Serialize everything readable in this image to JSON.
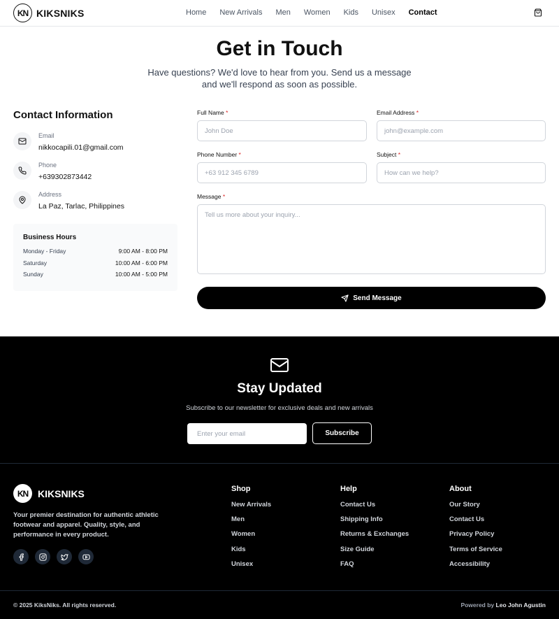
{
  "nav": {
    "logo_mark": "KN",
    "brand": "KIKSNIKS",
    "links": [
      "Home",
      "New Arrivals",
      "Men",
      "Women",
      "Kids",
      "Unisex",
      "Contact"
    ],
    "active": "Contact",
    "cart_icon": "cart-icon"
  },
  "hero": {
    "title": "Get in Touch",
    "subtitle": "Have questions? We'd love to hear from you. Send us a message and we'll respond as soon as possible."
  },
  "contact_info": {
    "title": "Contact Information",
    "items": [
      {
        "icon": "mail-icon",
        "label": "Email",
        "value": "nikkocapili.01@gmail.com"
      },
      {
        "icon": "phone-icon",
        "label": "Phone",
        "value": "+639302873442"
      },
      {
        "icon": "map-pin-icon",
        "label": "Address",
        "value": "La Paz, Tarlac, Philippines"
      }
    ]
  },
  "hours": {
    "title": "Business Hours",
    "rows": [
      {
        "day": "Monday - Friday",
        "time": "9:00 AM - 8:00 PM"
      },
      {
        "day": "Saturday",
        "time": "10:00 AM - 6:00 PM"
      },
      {
        "day": "Sunday",
        "time": "10:00 AM - 5:00 PM"
      }
    ]
  },
  "form": {
    "full_name": {
      "label": "Full Name",
      "placeholder": "John Doe"
    },
    "email": {
      "label": "Email Address",
      "placeholder": "john@example.com"
    },
    "phone": {
      "label": "Phone Number",
      "placeholder": "+63 912 345 6789"
    },
    "subject": {
      "label": "Subject",
      "placeholder": "How can we help?"
    },
    "message": {
      "label": "Message",
      "placeholder": "Tell us more about your inquiry..."
    },
    "required_mark": "*",
    "submit": "Send Message"
  },
  "newsletter": {
    "title": "Stay Updated",
    "subtitle": "Subscribe to our newsletter for exclusive deals and new arrivals",
    "placeholder": "Enter your email",
    "button": "Subscribe"
  },
  "footer": {
    "brand": "KIKSNIKS",
    "logo_mark": "KN",
    "description": "Your premier destination for authentic athletic footwear and apparel. Quality, style, and performance in every product.",
    "socials": [
      "facebook-icon",
      "instagram-icon",
      "twitter-icon",
      "youtube-icon"
    ],
    "columns": [
      {
        "title": "Shop",
        "links": [
          "New Arrivals",
          "Men",
          "Women",
          "Kids",
          "Unisex"
        ]
      },
      {
        "title": "Help",
        "links": [
          "Contact Us",
          "Shipping Info",
          "Returns & Exchanges",
          "Size Guide",
          "FAQ"
        ]
      },
      {
        "title": "About",
        "links": [
          "Our Story",
          "Contact Us",
          "Privacy Policy",
          "Terms of Service",
          "Accessibility"
        ]
      }
    ],
    "copyright": "© 2025 KiksNiks. All rights reserved.",
    "powered_prefix": "Powered by",
    "powered_name": "Leo John Agustin"
  },
  "colors": {
    "accent": "#000000",
    "required": "#dc2626",
    "dark_bg": "#000000"
  }
}
